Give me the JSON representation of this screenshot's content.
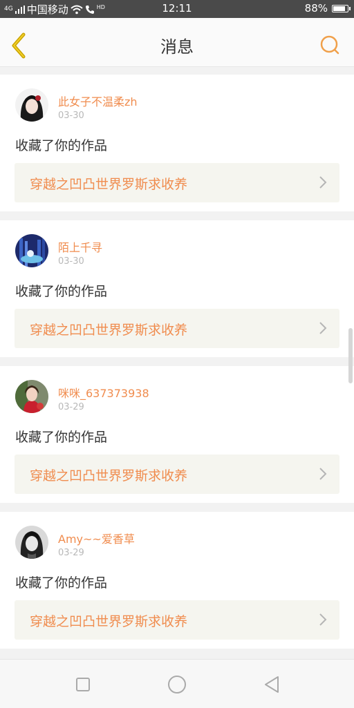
{
  "status_bar": {
    "network": "4G",
    "carrier": "中国移动",
    "hd": "HD",
    "time": "12:11",
    "battery": "88%",
    "battery_level": 0.88
  },
  "header": {
    "title": "消息",
    "accent_color": "#f0a04a"
  },
  "messages": [
    {
      "user": "此女子不温柔zh",
      "date": "03-30",
      "action": "收藏了你的作品",
      "work": "穿越之凹凸世界罗斯求收养"
    },
    {
      "user": "陌上千寻",
      "date": "03-30",
      "action": "收藏了你的作品",
      "work": "穿越之凹凸世界罗斯求收养"
    },
    {
      "user": "咪咪_637373938",
      "date": "03-29",
      "action": "收藏了你的作品",
      "work": "穿越之凹凸世界罗斯求收养"
    },
    {
      "user": "Amy~~爱香草",
      "date": "03-29",
      "action": "收藏了你的作品",
      "work": "穿越之凹凸世界罗斯求收养"
    }
  ],
  "colors": {
    "username": "#f08c4e",
    "link_bg": "#f5f5ef"
  }
}
